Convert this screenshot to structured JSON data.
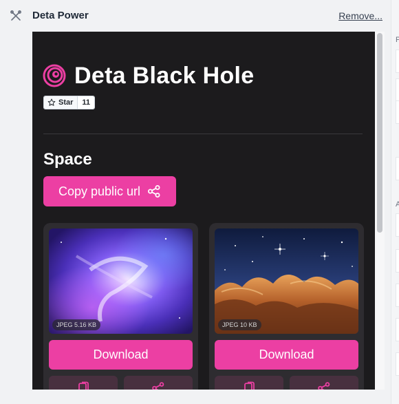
{
  "header": {
    "title": "Deta Power",
    "remove_label": "Remove..."
  },
  "page": {
    "brand_title": "Deta Black Hole",
    "star_label": "Star",
    "star_count": "11",
    "section_title": "Space",
    "copy_url_label": "Copy public url"
  },
  "cards": [
    {
      "file_info": "JPEG 5.16 KB",
      "download_label": "Download"
    },
    {
      "file_info": "JPEG 10 KB",
      "download_label": "Download"
    }
  ],
  "colors": {
    "accent": "#ec3fa3",
    "frame_bg": "#1c1b1d",
    "card_bg": "#2e2c30"
  },
  "icons": [
    "tools-icon",
    "black-hole-logo-icon",
    "star-icon",
    "share-icon",
    "copy-icon"
  ]
}
